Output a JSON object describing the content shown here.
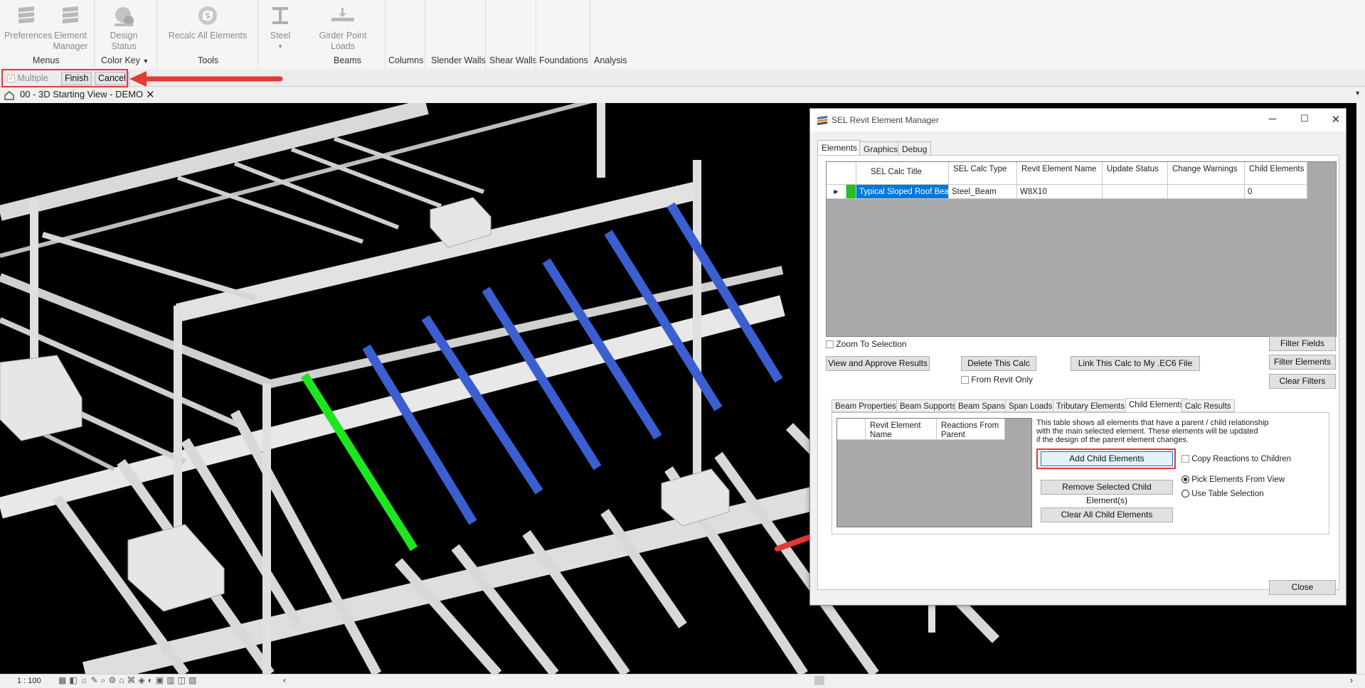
{
  "ribbon": {
    "buttons": [
      {
        "label": "Preferences",
        "icon": "preferences-icon"
      },
      {
        "label": "Element Manager",
        "icon": "element-manager-icon"
      },
      {
        "label": "Design Status",
        "icon": "design-status-icon"
      },
      {
        "label": "Recalc All Elements",
        "icon": "recalc-icon"
      },
      {
        "label": "Steel",
        "icon": "steel-beam-icon"
      },
      {
        "label": "Girder Point Loads",
        "icon": "girder-point-loads-icon"
      }
    ],
    "groups": [
      "Menus",
      "Color Key",
      "Tools",
      "Beams"
    ],
    "tabs": [
      "Columns",
      "Slender Walls",
      "Shear Walls",
      "Foundations",
      "Analysis"
    ]
  },
  "options_bar": {
    "multiple_label": "Multiple",
    "finish_label": "Finish",
    "cancel_label": "Cancel"
  },
  "view": {
    "title": "00 - 3D Starting View - DEMO",
    "scale": "1 : 100"
  },
  "dialog": {
    "title": "SEL Revit Element Manager",
    "tabs": [
      "Elements",
      "Graphics",
      "Debug"
    ],
    "grid": {
      "headers": [
        "SEL Calc Title",
        "SEL Calc Type",
        "Revit Element Name",
        "Update Status",
        "Change Warnings",
        "Child Elements"
      ],
      "rows": [
        {
          "title": "Typical Sloped Roof Beam",
          "type": "Steel_Beam",
          "revit_name": "W8X10",
          "update_status": "",
          "change_warnings": "",
          "child_elements": "0",
          "status_color": "#22c022"
        }
      ]
    },
    "zoom_to_selection": "Zoom To Selection",
    "buttons": {
      "filter_fields": "Filter Fields",
      "filter_elements": "Filter Elements",
      "clear_filters": "Clear Filters",
      "view_approve": "View and Approve Results",
      "delete_calc": "Delete This Calc",
      "link_calc": "Link This Calc to My .EC6 File",
      "close": "Close"
    },
    "from_revit_only": "From Revit Only",
    "subtabs": [
      "Beam Properties",
      "Beam Supports",
      "Beam Spans",
      "Span Loads",
      "Tributary Elements",
      "Child Elements",
      "Calc Results"
    ],
    "child_panel": {
      "headers": [
        "Revit Element Name",
        "Reactions From Parent"
      ],
      "description": [
        "This table shows all elements that have a parent / child relationship",
        "with the main selected element.  These elements will be updated",
        "if the design of the parent element changes."
      ],
      "add_child": "Add Child Elements",
      "remove_child": "Remove Selected Child Element(s)",
      "clear_children": "Clear All Child Elements",
      "copy_reactions": "Copy Reactions to Children",
      "pick_from_view": "Pick Elements From View",
      "use_table": "Use Table Selection"
    }
  },
  "colors": {
    "accent": "#0078d7",
    "highlight": "#e53935",
    "selected_beam": "#1ee61e",
    "child_beam": "#3b5fd0"
  }
}
